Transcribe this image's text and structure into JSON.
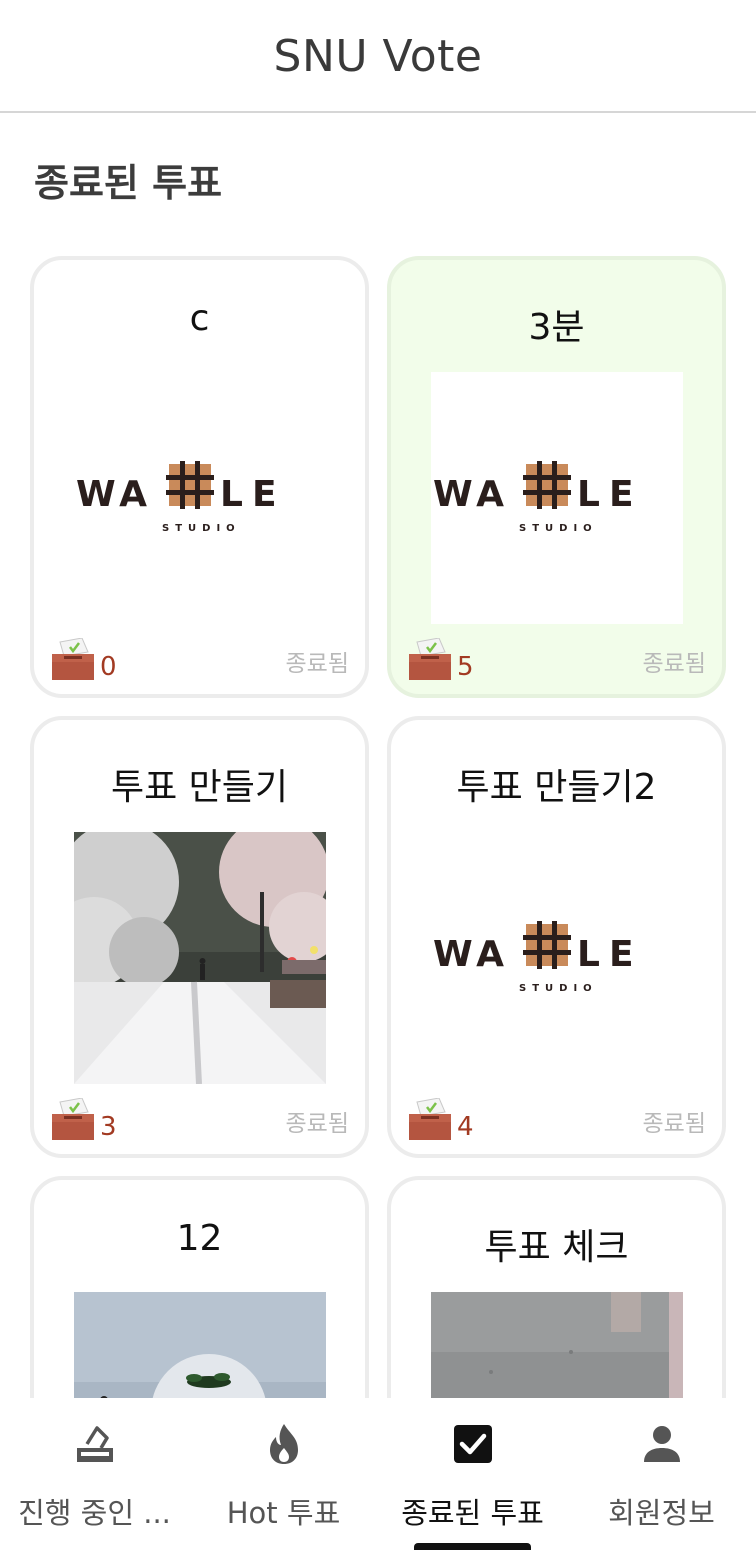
{
  "app": {
    "title": "SNU Vote"
  },
  "section": {
    "title": "종료된 투표"
  },
  "cards": [
    {
      "title": "c",
      "votes": "0",
      "status": "종료됨",
      "image": "waffle-studio-logo",
      "highlighted": false
    },
    {
      "title": "3분",
      "votes": "5",
      "status": "종료됨",
      "image": "waffle-studio-logo",
      "highlighted": true
    },
    {
      "title": "투표 만들기",
      "votes": "3",
      "status": "종료됨",
      "image": "snowy-street-photo",
      "highlighted": false
    },
    {
      "title": "투표 만들기2",
      "votes": "4",
      "status": "종료됨",
      "image": "waffle-studio-logo",
      "highlighted": false
    },
    {
      "title": "12",
      "votes": "",
      "status": "",
      "image": "snowman-photo",
      "highlighted": false
    },
    {
      "title": "투표 체크",
      "votes": "",
      "status": "",
      "image": "pavement-photo",
      "highlighted": false
    }
  ],
  "logo": {
    "left": "WA",
    "right": "LE",
    "sub": "STUDIO"
  },
  "nav": {
    "items": [
      {
        "label": "진행 중인 ...",
        "icon": "ballot-icon"
      },
      {
        "label": "Hot 투표",
        "icon": "fire-icon"
      },
      {
        "label": "종료된 투표",
        "icon": "checkbox-icon",
        "active": true
      },
      {
        "label": "회원정보",
        "icon": "person-icon"
      }
    ]
  },
  "colors": {
    "highlight_card": "#f2fdea",
    "vote_count": "#a23a22",
    "status_text": "#b9b9b9",
    "logo_accent": "#c98a5a"
  }
}
